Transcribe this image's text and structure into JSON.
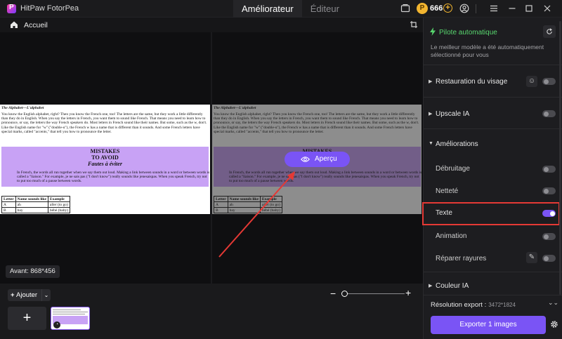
{
  "app": {
    "name": "HitPaw FotorPea",
    "coins": "666"
  },
  "tabs": [
    {
      "label": "Améliorateur",
      "active": true
    },
    {
      "label": "Éditeur",
      "active": false
    }
  ],
  "breadcrumb": {
    "home": "Accueil"
  },
  "document": {
    "title": "The Alphabet—L'alphabet",
    "paragraph": "You know the English alphabet, right? Then you know the French one, too! The letters are the same, but they work a little differently than they do in English. When you say the letters in French, you want them to sound like French. That means you need to learn how to pronounce, or say, the letters the way French speakers do. Most letters in French sound like their names. But some, such as the w, don't. Like the English name for \"w\" (\"double-u\"), the French w has a name that is different than it sounds. And some French letters have special marks, called \"accents,\" that tell you how to pronounce the letter.",
    "box_h1": "MISTAKES",
    "box_h2": "TO AVOID",
    "box_h3": "Fautes à éviter",
    "box_text": "In French, the words all run together when we say them out loud. Making a link between sounds in a word or between words is called a \"liaison.\" For example, je ne sais pas (\"I don't know\") really sounds like jenesaispas. When you speak French, try not to put too much of a pause between words.",
    "table_headers": [
      "Letter",
      "Name sounds like",
      "Example"
    ],
    "table_rows": [
      [
        "A",
        "ah",
        "aller (to go)"
      ],
      [
        "B",
        "bay",
        "bébé (baby)"
      ]
    ]
  },
  "preview": {
    "apercu_label": "Aperçu",
    "avant_label": "Avant: 868*456"
  },
  "bottom": {
    "add_label": "Ajouter",
    "zoom_minus": "−",
    "zoom_plus": "+",
    "zoom_level": 0.05
  },
  "panel": {
    "auto_title": "Pilote automatique",
    "auto_desc": "Le meilleur modèle a été automatiquement sélectionné pour vous",
    "sections": {
      "face": "Restauration du visage",
      "upscale": "Upscale IA",
      "improvements": "Améliorations",
      "denoise": "Débruitage",
      "sharpness": "Netteté",
      "text": "Texte",
      "animation": "Animation",
      "scratch": "Réparer rayures",
      "color": "Couleur IA"
    },
    "toggles": {
      "face": false,
      "upscale": false,
      "denoise": false,
      "sharpness": false,
      "text": true,
      "animation": false,
      "scratch": false
    },
    "export_res_label": "Résolution export :",
    "export_res_value": "3472*1824",
    "export_button": "Exporter 1 images"
  },
  "colors": {
    "accent": "#7a54f5",
    "autopilot_green": "#58d66e",
    "highlight_red": "#e53935"
  }
}
